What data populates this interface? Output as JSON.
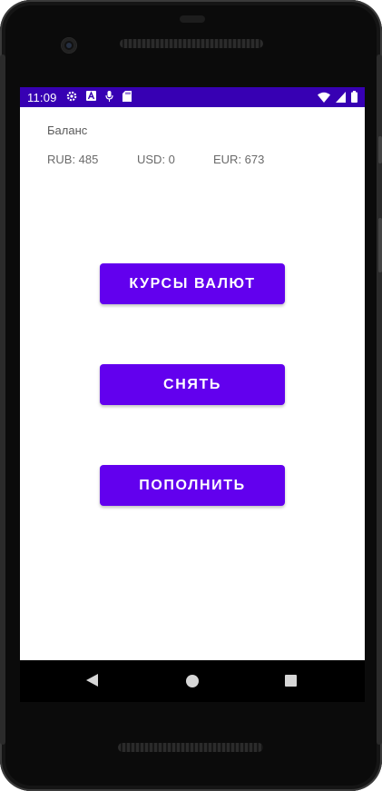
{
  "status_bar": {
    "time": "11:09",
    "background_color": "#3700b3",
    "left_icons": [
      "gear-icon",
      "font-a-icon",
      "microphone-icon",
      "sd-card-icon"
    ],
    "right_icons": [
      "wifi-icon",
      "signal-icon",
      "battery-icon"
    ]
  },
  "balance": {
    "label": "Баланс",
    "rub": "RUB: 485",
    "usd": "USD: 0",
    "eur": "EUR: 673"
  },
  "buttons": {
    "rates_label": "КУРСЫ ВАЛЮТ",
    "withdraw_label": "СНЯТЬ",
    "deposit_label": "ПОПОЛНИТЬ",
    "color": "#6200ee"
  },
  "nav_bar": {
    "icons": [
      "back-icon",
      "home-icon",
      "recents-icon"
    ]
  }
}
